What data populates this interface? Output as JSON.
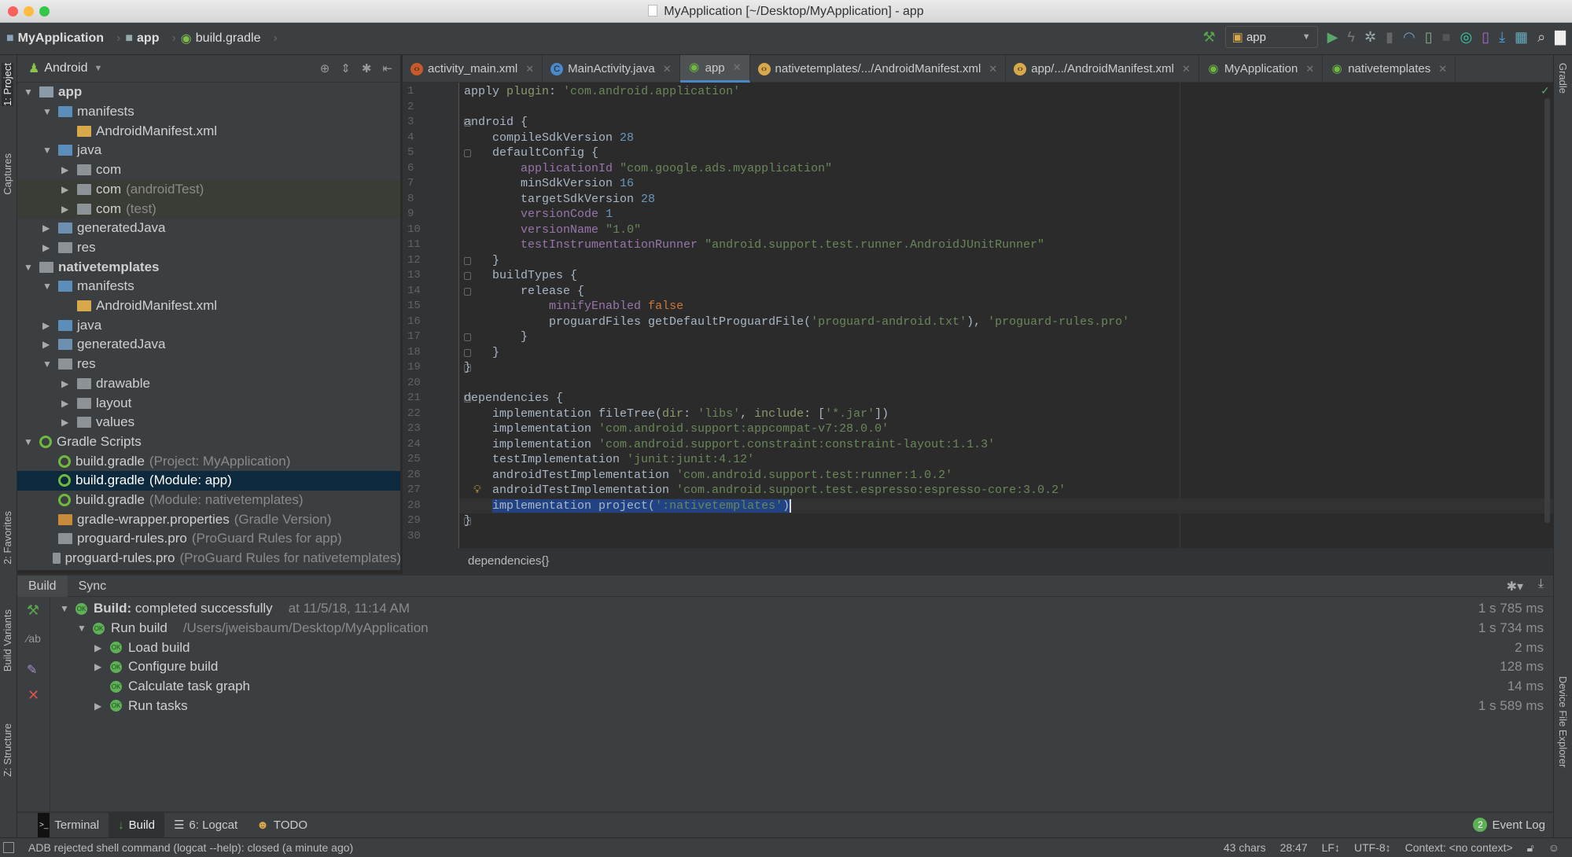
{
  "window": {
    "title": "MyApplication [~/Desktop/MyApplication] - app"
  },
  "navbar": {
    "crumbs": [
      "MyApplication",
      "app",
      "build.gradle"
    ],
    "run_config": "app"
  },
  "left_stripe": [
    "1: Project",
    "Captures",
    "2: Favorites",
    "Build Variants",
    "Z: Structure"
  ],
  "right_stripe": [
    "Gradle",
    "Device File Explorer"
  ],
  "project": {
    "view_mode": "Android",
    "tree": [
      {
        "label": "app",
        "depth": 0,
        "arrow": "down",
        "icon": "module",
        "bold": true
      },
      {
        "label": "manifests",
        "depth": 1,
        "arrow": "down",
        "icon": "folder-blue"
      },
      {
        "label": "AndroidManifest.xml",
        "depth": 2,
        "arrow": "",
        "icon": "manifest"
      },
      {
        "label": "java",
        "depth": 1,
        "arrow": "down",
        "icon": "folder-blue"
      },
      {
        "label": "com",
        "depth": 2,
        "arrow": "right",
        "icon": "package"
      },
      {
        "label": "com",
        "hint": "(androidTest)",
        "depth": 2,
        "arrow": "right",
        "icon": "package",
        "highlight": true
      },
      {
        "label": "com",
        "hint": "(test)",
        "depth": 2,
        "arrow": "right",
        "icon": "package",
        "highlight": true
      },
      {
        "label": "generatedJava",
        "depth": 1,
        "arrow": "right",
        "icon": "folder-gen"
      },
      {
        "label": "res",
        "depth": 1,
        "arrow": "right",
        "icon": "folder-res"
      },
      {
        "label": "nativetemplates",
        "depth": 0,
        "arrow": "down",
        "icon": "library",
        "bold": true
      },
      {
        "label": "manifests",
        "depth": 1,
        "arrow": "down",
        "icon": "folder-blue"
      },
      {
        "label": "AndroidManifest.xml",
        "depth": 2,
        "arrow": "",
        "icon": "manifest"
      },
      {
        "label": "java",
        "depth": 1,
        "arrow": "right",
        "icon": "folder-blue"
      },
      {
        "label": "generatedJava",
        "depth": 1,
        "arrow": "right",
        "icon": "folder-gen"
      },
      {
        "label": "res",
        "depth": 1,
        "arrow": "down",
        "icon": "folder-res"
      },
      {
        "label": "drawable",
        "depth": 2,
        "arrow": "right",
        "icon": "package"
      },
      {
        "label": "layout",
        "depth": 2,
        "arrow": "right",
        "icon": "package"
      },
      {
        "label": "values",
        "depth": 2,
        "arrow": "right",
        "icon": "package"
      },
      {
        "label": "Gradle Scripts",
        "depth": 0,
        "arrow": "down",
        "icon": "gradle"
      },
      {
        "label": "build.gradle",
        "hint": "(Project: MyApplication)",
        "depth": 1,
        "arrow": "",
        "icon": "gradle"
      },
      {
        "label": "build.gradle",
        "hint": "(Module: app)",
        "depth": 1,
        "arrow": "",
        "icon": "gradle",
        "selected": true
      },
      {
        "label": "build.gradle",
        "hint": "(Module: nativetemplates)",
        "depth": 1,
        "arrow": "",
        "icon": "gradle"
      },
      {
        "label": "gradle-wrapper.properties",
        "hint": "(Gradle Version)",
        "depth": 1,
        "arrow": "",
        "icon": "properties"
      },
      {
        "label": "proguard-rules.pro",
        "hint": "(ProGuard Rules for app)",
        "depth": 1,
        "arrow": "",
        "icon": "file"
      },
      {
        "label": "proguard-rules.pro",
        "hint": "(ProGuard Rules for nativetemplates)",
        "depth": 1,
        "arrow": "",
        "icon": "file"
      }
    ]
  },
  "tabs": [
    {
      "label": "activity_main.xml",
      "icon": "xml"
    },
    {
      "label": "MainActivity.java",
      "icon": "class"
    },
    {
      "label": "app",
      "icon": "gradle",
      "active": true
    },
    {
      "label": "nativetemplates/.../AndroidManifest.xml",
      "icon": "manifest"
    },
    {
      "label": "app/.../AndroidManifest.xml",
      "icon": "manifest"
    },
    {
      "label": "MyApplication",
      "icon": "gradle"
    },
    {
      "label": "nativetemplates",
      "icon": "gradle"
    }
  ],
  "editor": {
    "caret_line": 28,
    "lines": [
      [
        [
          "p",
          "apply "
        ],
        [
          "named",
          "plugin"
        ],
        [
          "p",
          ": "
        ],
        [
          "str",
          "'com.android.application'"
        ]
      ],
      [],
      [
        [
          "p",
          "android {"
        ]
      ],
      [
        [
          "p",
          "    compileSdkVersion "
        ],
        [
          "num",
          "28"
        ]
      ],
      [
        [
          "p",
          "    defaultConfig {"
        ]
      ],
      [
        [
          "p",
          "        "
        ],
        [
          "kw",
          "applicationId"
        ],
        [
          "p",
          " "
        ],
        [
          "str",
          "\"com.google.ads.myapplication\""
        ]
      ],
      [
        [
          "p",
          "        minSdkVersion "
        ],
        [
          "num",
          "16"
        ]
      ],
      [
        [
          "p",
          "        targetSdkVersion "
        ],
        [
          "num",
          "28"
        ]
      ],
      [
        [
          "p",
          "        "
        ],
        [
          "kw",
          "versionCode"
        ],
        [
          "p",
          " "
        ],
        [
          "num",
          "1"
        ]
      ],
      [
        [
          "p",
          "        "
        ],
        [
          "kw",
          "versionName"
        ],
        [
          "p",
          " "
        ],
        [
          "str",
          "\"1.0\""
        ]
      ],
      [
        [
          "p",
          "        "
        ],
        [
          "kw",
          "testInstrumentationRunner"
        ],
        [
          "p",
          " "
        ],
        [
          "str",
          "\"android.support.test.runner.AndroidJUnitRunner\""
        ]
      ],
      [
        [
          "p",
          "    }"
        ]
      ],
      [
        [
          "p",
          "    buildTypes {"
        ]
      ],
      [
        [
          "p",
          "        release {"
        ]
      ],
      [
        [
          "p",
          "            "
        ],
        [
          "kw",
          "minifyEnabled"
        ],
        [
          "p",
          " "
        ],
        [
          "bool",
          "false"
        ]
      ],
      [
        [
          "p",
          "            proguardFiles getDefaultProguardFile("
        ],
        [
          "str",
          "'proguard-android.txt'"
        ],
        [
          "p",
          "), "
        ],
        [
          "str",
          "'proguard-rules.pro'"
        ]
      ],
      [
        [
          "p",
          "        }"
        ]
      ],
      [
        [
          "p",
          "    }"
        ]
      ],
      [
        [
          "p",
          "}"
        ]
      ],
      [],
      [
        [
          "p",
          "dependencies {"
        ]
      ],
      [
        [
          "p",
          "    implementation fileTree("
        ],
        [
          "named",
          "dir"
        ],
        [
          "p",
          ": "
        ],
        [
          "str",
          "'libs'"
        ],
        [
          "p",
          ", "
        ],
        [
          "named",
          "include"
        ],
        [
          "p",
          ": ["
        ],
        [
          "str",
          "'*.jar'"
        ],
        [
          "p",
          "])"
        ]
      ],
      [
        [
          "p",
          "    implementation "
        ],
        [
          "str",
          "'com.android.support:appcompat-v7:28.0.0'"
        ]
      ],
      [
        [
          "p",
          "    implementation "
        ],
        [
          "str",
          "'com.android.support.constraint:constraint-layout:1.1.3'"
        ]
      ],
      [
        [
          "p",
          "    testImplementation "
        ],
        [
          "str",
          "'junit:junit:4.12'"
        ]
      ],
      [
        [
          "p",
          "    androidTestImplementation "
        ],
        [
          "str",
          "'com.android.support.test:runner:1.0.2'"
        ]
      ],
      [
        [
          "p",
          "    androidTestImplementation "
        ],
        [
          "str",
          "'com.android.support.test.espresso:espresso-core:3.0.2'"
        ]
      ],
      [
        [
          "p",
          "    "
        ],
        [
          "sel",
          "implementation project("
        ],
        [
          "selstr",
          "':nativetemplates'"
        ],
        [
          "sel",
          ")"
        ]
      ],
      [
        [
          "p",
          "}"
        ]
      ],
      []
    ],
    "breadcrumb": "dependencies{}"
  },
  "build": {
    "tabs": [
      "Build",
      "Sync"
    ],
    "rows": [
      {
        "label": "Build:",
        "label_rest": " completed successfully",
        "hint": "at 11/5/18, 11:14 AM",
        "time": "1 s 785 ms",
        "depth": 0,
        "arrow": "down"
      },
      {
        "label": "Run build",
        "hint": "/Users/jweisbaum/Desktop/MyApplication",
        "time": "1 s 734 ms",
        "depth": 1,
        "arrow": "down"
      },
      {
        "label": "Load build",
        "time": "2 ms",
        "depth": 2,
        "arrow": "right"
      },
      {
        "label": "Configure build",
        "time": "128 ms",
        "depth": 2,
        "arrow": "right"
      },
      {
        "label": "Calculate task graph",
        "time": "14 ms",
        "depth": 2,
        "arrow": ""
      },
      {
        "label": "Run tasks",
        "time": "1 s 589 ms",
        "depth": 2,
        "arrow": "right"
      }
    ],
    "ok_badge": "OK"
  },
  "bottom_tabs": [
    {
      "label": "Terminal",
      "icon": "terminal-icon"
    },
    {
      "label": "Build",
      "icon": "build-icon",
      "active": true
    },
    {
      "label": "6: Logcat",
      "icon": "logcat-icon"
    },
    {
      "label": "TODO",
      "icon": "todo-icon"
    }
  ],
  "event_log": {
    "label": "Event Log",
    "count": "2"
  },
  "status": {
    "message": "ADB rejected shell command (logcat --help): closed (a minute ago)",
    "chars": "43 chars",
    "position": "28:47",
    "line_sep": "LF↕",
    "encoding": "UTF-8↕",
    "context": "Context: <no context>"
  },
  "colors": {
    "accent": "#4a88c7",
    "selection": "#214283",
    "ok": "#5fb157",
    "keyword": "#9876aa",
    "string": "#6a8759",
    "number": "#6897bb"
  }
}
